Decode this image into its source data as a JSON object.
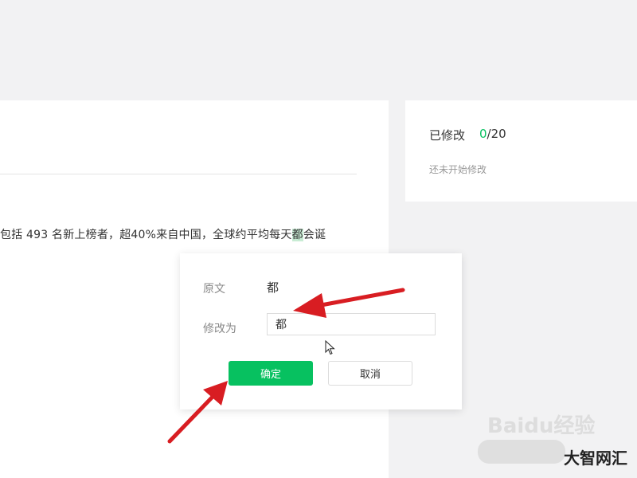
{
  "article": {
    "text_before": "包括 493 名新上榜者，超40%来自中国，全球约平均每天",
    "highlight": "都",
    "text_after": "会诞"
  },
  "sidebar": {
    "modified_label": "已修改",
    "modified_done": "0",
    "modified_total": "/20",
    "status": "还未开始修改"
  },
  "dialog": {
    "original_label": "原文",
    "original_value": "都",
    "edit_label": "修改为",
    "edit_value": "都",
    "confirm_label": "确定",
    "cancel_label": "取消"
  },
  "watermark": {
    "logo": "Baidu经验",
    "text": "大智网汇"
  },
  "colors": {
    "accent": "#07c160",
    "highlight": "#c8ecd4",
    "annotation": "#e0191f"
  }
}
